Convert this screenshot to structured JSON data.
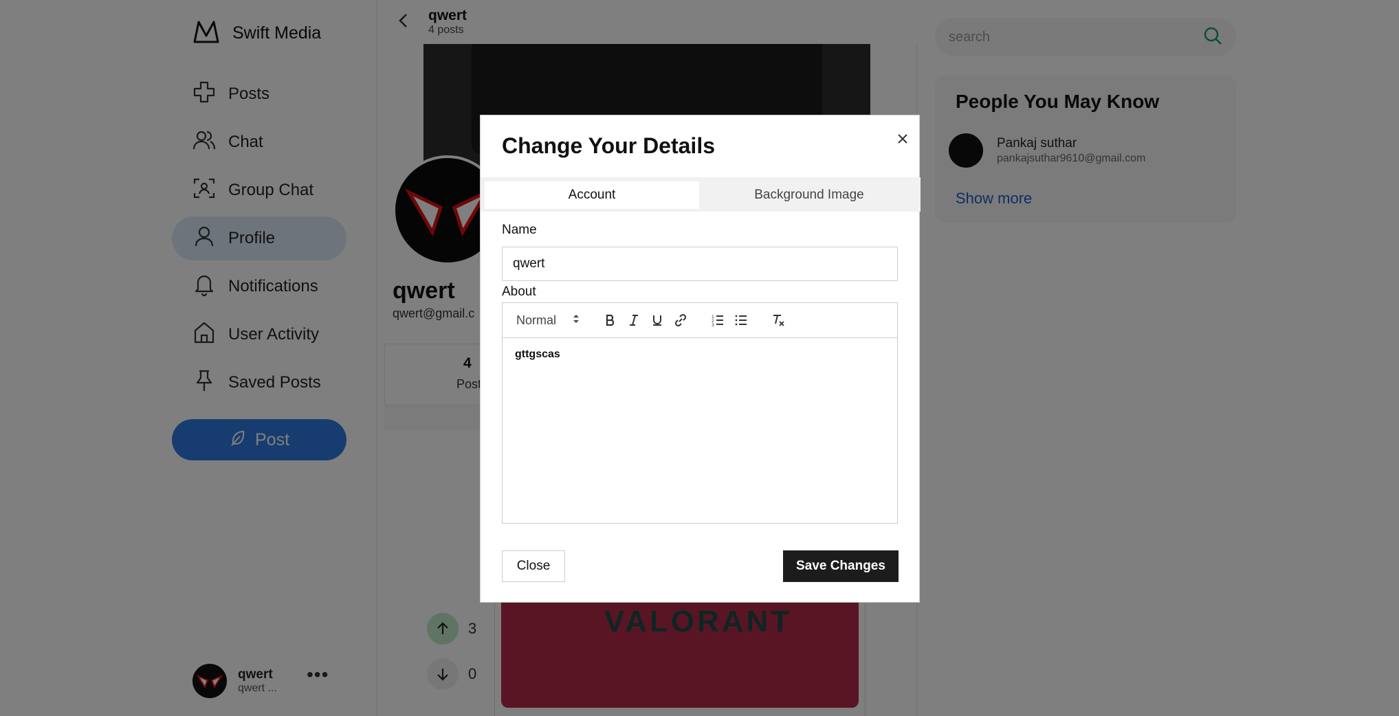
{
  "brand": {
    "name": "Swift Media",
    "icon": "mountain-logo-icon"
  },
  "nav": {
    "items": [
      {
        "label": "Posts",
        "icon": "cross-shape-icon"
      },
      {
        "label": "Chat",
        "icon": "users-icon"
      },
      {
        "label": "Group Chat",
        "icon": "scan-face-icon"
      },
      {
        "label": "Profile",
        "icon": "user-icon",
        "active": true
      },
      {
        "label": "Notifications",
        "icon": "bell-icon"
      },
      {
        "label": "User Activity",
        "icon": "home-icon"
      },
      {
        "label": "Saved Posts",
        "icon": "pin-icon"
      }
    ],
    "post_button": "Post"
  },
  "current_user": {
    "name": "qwert",
    "email": "qwert ..."
  },
  "profile_header": {
    "title": "qwert",
    "subtitle": "4 posts"
  },
  "profile": {
    "name": "qwert",
    "email": "qwert@gmail.c",
    "posts_count": "4",
    "posts_label": "Posts"
  },
  "post": {
    "upvotes": "3",
    "downvotes": "0",
    "image_text": "VALORANT"
  },
  "search": {
    "placeholder": "search"
  },
  "people_you_may_know": {
    "title": "People You May Know",
    "people": [
      {
        "name": "Pankaj suthar",
        "email": "pankajsuthar9610@gmail.com"
      }
    ],
    "show_more": "Show more"
  },
  "modal": {
    "title": "Change Your Details",
    "tabs": [
      {
        "label": "Account",
        "active": true
      },
      {
        "label": "Background Image",
        "active": false
      }
    ],
    "name_label": "Name",
    "name_value": "qwert",
    "about_label": "About",
    "editor": {
      "format": "Normal",
      "content": "gttgscas"
    },
    "close_button": "Close",
    "save_button": "Save Changes"
  },
  "colors": {
    "accent": "#2f7be0",
    "active_nav_bg": "#dde8f8",
    "dark_button": "#1c1c1c",
    "overlay": "rgba(0,0,0,0.5)"
  }
}
